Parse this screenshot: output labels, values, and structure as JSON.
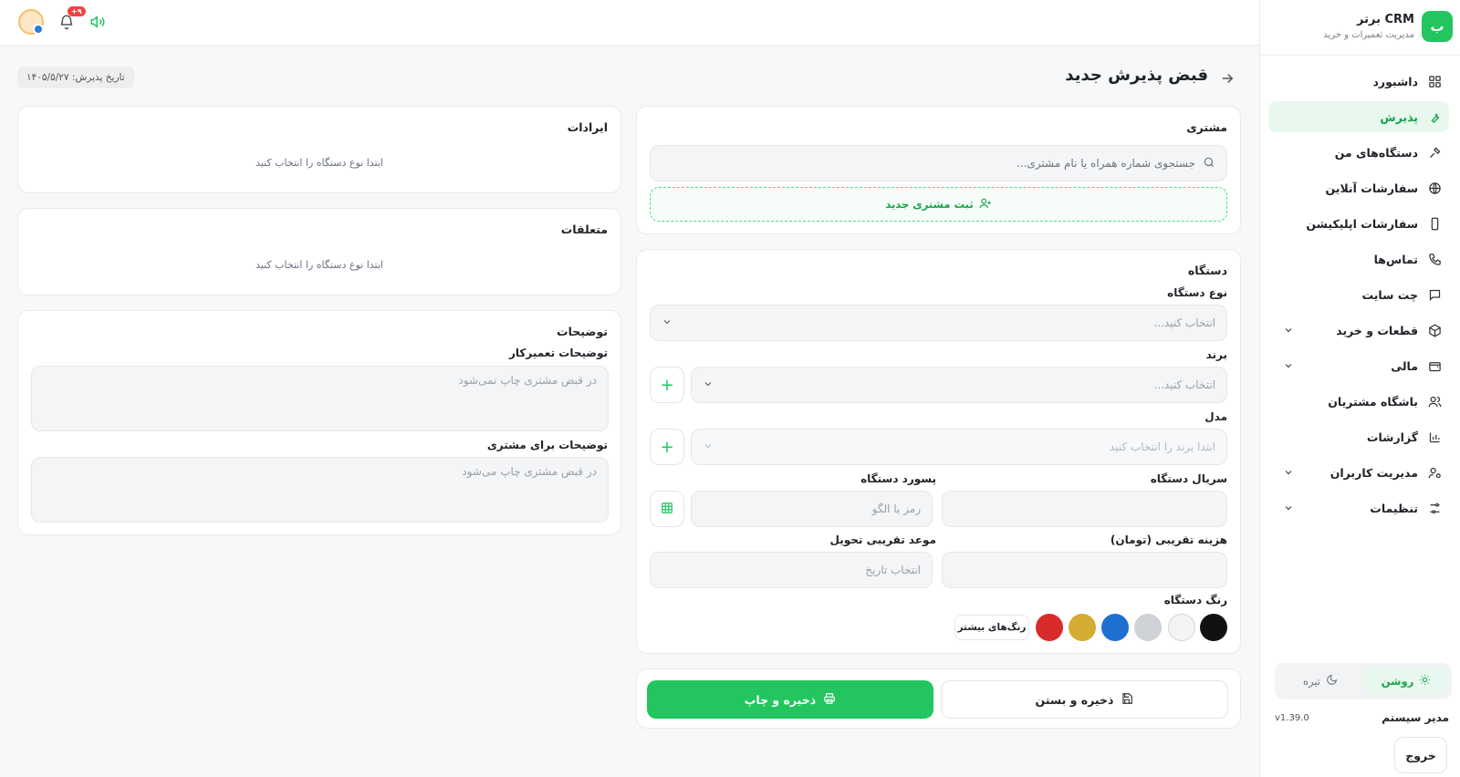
{
  "sidebar": {
    "logo_letter": "ب",
    "brand_title": "برتر CRM",
    "brand_subtitle": "مدیریت تعمیرات و خرید",
    "items": [
      {
        "label": "داشبورد",
        "icon": "grid-icon"
      },
      {
        "label": "پذیرش",
        "icon": "wrench-icon",
        "active": true
      },
      {
        "label": "دستگاه‌های من",
        "icon": "tools-icon"
      },
      {
        "label": "سفارشات آنلاین",
        "icon": "globe-icon"
      },
      {
        "label": "سفارشات اپلیکیشن",
        "icon": "phone-device-icon"
      },
      {
        "label": "تماس‌ها",
        "icon": "phone-icon"
      },
      {
        "label": "چت سایت",
        "icon": "chat-icon"
      },
      {
        "label": "قطعات و خرید",
        "icon": "box-icon",
        "expandable": true
      },
      {
        "label": "مالی",
        "icon": "wallet-icon",
        "expandable": true
      },
      {
        "label": "باشگاه مشتریان",
        "icon": "users-icon"
      },
      {
        "label": "گزارشات",
        "icon": "chart-icon"
      },
      {
        "label": "مدیریت کاربران",
        "icon": "user-gear-icon",
        "expandable": true
      },
      {
        "label": "تنظیمات",
        "icon": "sliders-icon",
        "expandable": true
      }
    ],
    "theme_light": "روشن",
    "theme_dark": "تیره",
    "user_role": "مدیر سیستم",
    "version": "v1.39.0",
    "logout": "خروج"
  },
  "topbar": {
    "notification_count": "+۹"
  },
  "header": {
    "title": "قبض پذیرش جدید",
    "date_label": "تاریخ پذیرش: ۱۴۰۵/۵/۲۷"
  },
  "customer": {
    "title": "مشتری",
    "search_placeholder": "جستجوی شماره همراه یا نام مشتری...",
    "new_customer": "ثبت مشتری جدید"
  },
  "device": {
    "title": "دستگاه",
    "type_label": "نوع دستگاه",
    "type_placeholder": "انتخاب کنید...",
    "brand_label": "برند",
    "brand_placeholder": "انتخاب کنید...",
    "model_label": "مدل",
    "model_placeholder": "ابتدا برند را انتخاب کنید",
    "serial_label": "سریال دستگاه",
    "password_label": "پسورد دستگاه",
    "password_placeholder": "رمز یا الگو",
    "cost_label": "هزینه تقریبی (تومان)",
    "delivery_label": "موعد تقریبی تحویل",
    "delivery_placeholder": "انتخاب تاریخ",
    "color_label": "رنگ دستگاه",
    "more_colors": "رنگ‌های بیشتر",
    "colors": [
      "#111111",
      "#f4f4f4",
      "#cfd2d6",
      "#1f6fd1",
      "#d4ac32",
      "#d92b2b"
    ]
  },
  "issues": {
    "title": "ایرادات",
    "hint": "ابتدا نوع دستگاه را انتخاب کنید"
  },
  "accessories": {
    "title": "متعلقات",
    "hint": "ابتدا نوع دستگاه را انتخاب کنید"
  },
  "notes": {
    "title": "توضیحات",
    "tech_label": "توضیحات تعمیرکار",
    "tech_placeholder": "در قبض مشتری چاپ نمی‌شود",
    "customer_label": "توضیحات برای مشتری",
    "customer_placeholder": "در قبض مشتری چاپ می‌شود"
  },
  "actions": {
    "save_close": "ذخیره و بستن",
    "save_print": "ذخیره و چاپ"
  }
}
